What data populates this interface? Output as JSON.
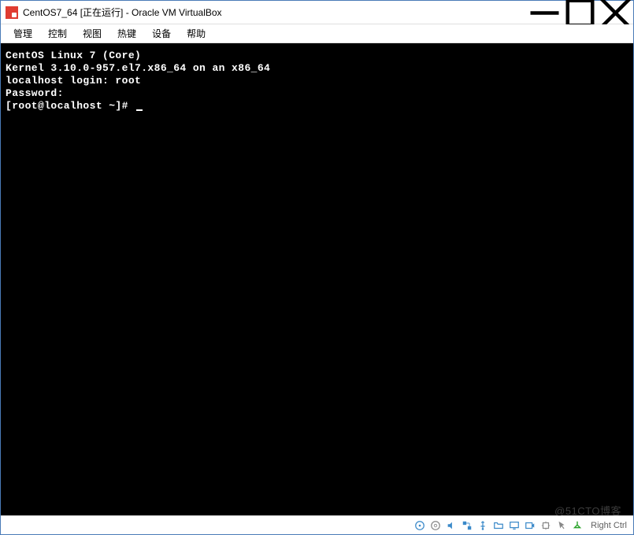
{
  "titlebar": {
    "title": "CentOS7_64 [正在运行] - Oracle VM VirtualBox"
  },
  "menubar": {
    "items": [
      {
        "label": "管理"
      },
      {
        "label": "控制"
      },
      {
        "label": "视图"
      },
      {
        "label": "热键"
      },
      {
        "label": "设备"
      },
      {
        "label": "帮助"
      }
    ]
  },
  "terminal": {
    "lines": [
      "CentOS Linux 7 (Core)",
      "Kernel 3.10.0-957.el7.x86_64 on an x86_64",
      "",
      "localhost login: root",
      "Password:",
      "[root@localhost ~]# "
    ]
  },
  "statusbar": {
    "host_key": "Right Ctrl"
  },
  "watermark": "@51CTO博客"
}
